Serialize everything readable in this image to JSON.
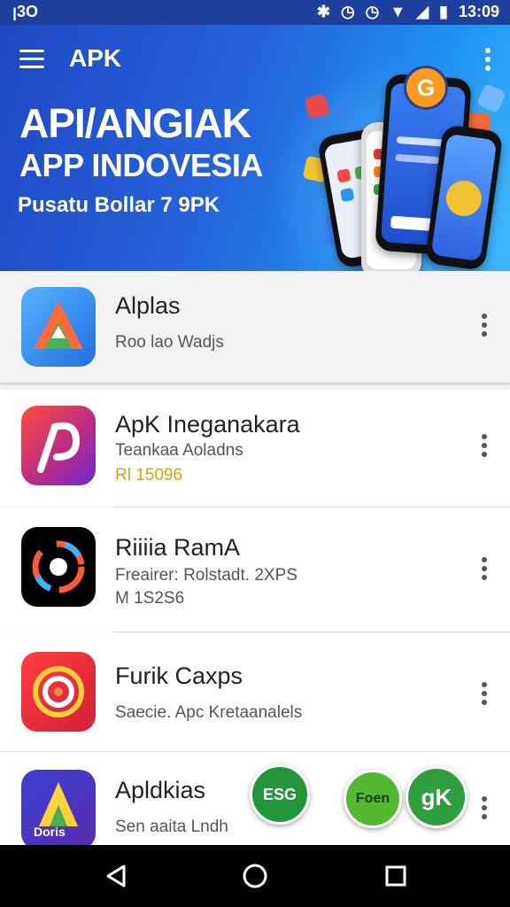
{
  "status_bar": {
    "left_text": "ꞁ3O",
    "time": "13:09",
    "icons": [
      "bluetooth-icon",
      "alarm-icon",
      "alarm-icon",
      "wifi-icon",
      "signal-icon",
      "battery-icon"
    ]
  },
  "header": {
    "title": "APK",
    "menu_icon": "hamburger-icon",
    "more_icon": "more-vert-icon"
  },
  "banner": {
    "line1": "API/ANGIAK",
    "line2": "APP INDOVESIA",
    "subtitle": "Pusatu Bollar 7 9PK",
    "logo_letter": "G"
  },
  "apps": [
    {
      "name": "Alplas",
      "line1": "Roo lao Wadjs",
      "line2": "",
      "line2_color": "#555555"
    },
    {
      "name": "ApK Ineganakara",
      "line1": "Teankaa Aoladns",
      "line2": "Rl 15096",
      "line2_color": "#d9a400"
    },
    {
      "name": "Riiiia RamA",
      "line1": "Freairer: Rolstadt. 2XPS",
      "line2": "M 1S2S6",
      "line2_color": "#555555"
    },
    {
      "name": "Furik Caxps",
      "line1": "Saecie. Apc Kretaanalels",
      "line2": "",
      "line2_color": "#555555"
    },
    {
      "name": "Apldkias",
      "line1": "Sen aaita Lndh",
      "line2": "",
      "line2_color": "#555555"
    }
  ],
  "app_icon_text": {
    "last": "Doris"
  },
  "badges": [
    {
      "label": "ESG",
      "color": "#22963a"
    },
    {
      "label": "Foen",
      "color": "#53b832"
    },
    {
      "label": "gK",
      "color": "#2e9e3e"
    }
  ],
  "nav": [
    "back-icon",
    "home-icon",
    "recents-icon"
  ]
}
